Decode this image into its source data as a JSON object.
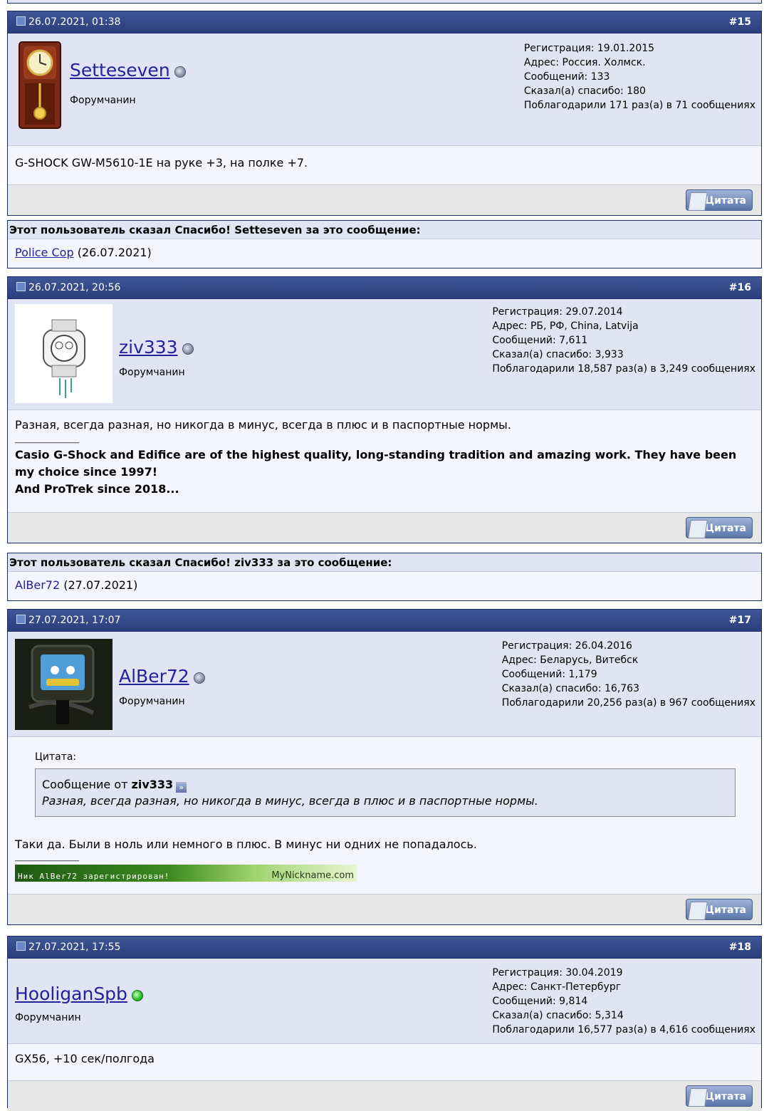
{
  "posts": [
    {
      "date": "26.07.2021, 01:38",
      "number": "#15",
      "username": "Setteseven",
      "user_title": "Форумчанин",
      "status": "offline",
      "stats": [
        "Регистрация: 19.01.2015",
        "Адрес: Россия. Холмск.",
        "Сообщений: 133",
        "Сказал(а) спасибо: 180",
        "Поблагодарили 171 раз(а) в 71 сообщениях"
      ],
      "message": "G-SHOCK GW-M5610-1E на руке +3, на полке +7.",
      "quote_label": "Цитата"
    },
    {
      "date": "26.07.2021, 20:56",
      "number": "#16",
      "username": "ziv333",
      "user_title": "Форумчанин",
      "status": "offline",
      "stats": [
        "Регистрация: 29.07.2014",
        "Адрес: РБ, РФ, China, Latvija",
        "Сообщений: 7,611",
        "Сказал(а) спасибо: 3,933",
        "Поблагодарили 18,587 раз(а) в 3,249 сообщениях"
      ],
      "message": "Разная, всегда разная, но никогда в минус, всегда в плюс и в паспортные нормы.",
      "sig_line": "__________________",
      "signature": "Casio G-Shock and Edifice are of the highest quality, long-standing tradition and amazing work. They have been my choice since 1997!",
      "signature2": "And ProTrek since 2018...",
      "quote_label": "Цитата"
    },
    {
      "date": "27.07.2021, 17:07",
      "number": "#17",
      "username": "AlBer72",
      "user_title": "Форумчанин",
      "status": "offline",
      "stats": [
        "Регистрация: 26.04.2016",
        "Адрес: Беларусь, Витебск",
        "Сообщений: 1,179",
        "Сказал(а) спасибо: 16,763",
        "Поблагодарили 20,256 раз(а) в 967 сообщениях"
      ],
      "quote_caption": "Цитата:",
      "quoted_prefix": "Сообщение от",
      "quoted_author": "ziv333",
      "quoted_text": "Разная, всегда разная, но никогда в минус, всегда в плюс и в паспортные нормы.",
      "message": "Таки да. Были в ноль или немного в плюс. В минус ни одних не попадалось.",
      "sig_line": "__________________",
      "nickbar_left": "Ник AlBer72 зарегистрирован!",
      "nickbar_right": "MyNickname.com",
      "quote_label": "Цитата"
    },
    {
      "date": "27.07.2021, 17:55",
      "number": "#18",
      "username": "HooliganSpb",
      "user_title": "Форумчанин",
      "status": "online",
      "stats": [
        "Регистрация: 30.04.2019",
        "Адрес: Санкт-Петербург",
        "Сообщений: 9,814",
        "Сказал(а) спасибо: 5,314",
        "Поблагодарили 16,577 раз(а) в 4,616 сообщениях"
      ],
      "message": "GX56, +10 сек/полгода",
      "quote_label": "Цитата"
    }
  ],
  "thanks": [
    {
      "title": "Этот пользователь сказал Спасибо! Setteseven за это сообщение:",
      "user": "Police Cop",
      "date": "(26.07.2021)"
    },
    {
      "title": "Этот пользователь сказал Спасибо! ziv333 за это сообщение:",
      "user": "AlBer72",
      "date": "(27.07.2021)"
    }
  ]
}
